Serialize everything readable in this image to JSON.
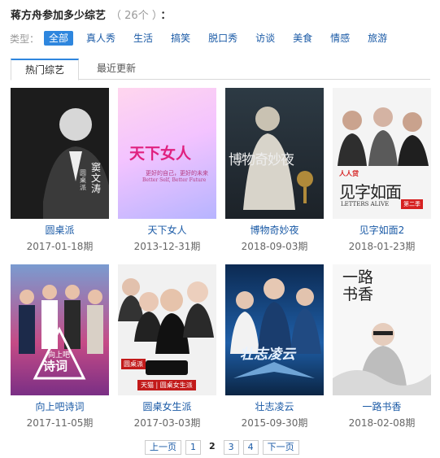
{
  "header": {
    "title": "蒋方舟参加多少综艺",
    "count": "（ 26个 ）",
    "colon": "："
  },
  "filters": {
    "label": "类型：",
    "items": [
      "全部",
      "真人秀",
      "生活",
      "搞笑",
      "脱口秀",
      "访谈",
      "美食",
      "情感",
      "旅游"
    ],
    "active": "全部"
  },
  "tabs": [
    {
      "label": "热门综艺",
      "active": true
    },
    {
      "label": "最近更新",
      "active": false
    }
  ],
  "shows": [
    {
      "name": "圆桌派",
      "date": "2017-01-18期",
      "poster_text": [
        "圆桌派",
        "窦文涛"
      ]
    },
    {
      "name": "天下女人",
      "date": "2013-12-31期",
      "poster_text": [
        "天下女人",
        "更好的自己，更好的未来",
        "Better Self, Better Future"
      ]
    },
    {
      "name": "博物奇妙夜",
      "date": "2018-09-03期",
      "poster_text": [
        "博物奇妙夜"
      ]
    },
    {
      "name": "见字如面2",
      "date": "2018-01-23期",
      "poster_text": [
        "见字如面",
        "LETTERS ALIVE",
        "第二季"
      ]
    },
    {
      "name": "向上吧诗词",
      "date": "2017-11-05期",
      "poster_text": [
        "向上吧",
        "诗词"
      ]
    },
    {
      "name": "圆桌女生派",
      "date": "2017-03-03期",
      "poster_text": [
        "圆桌派",
        "天猫 | 圆桌女生派"
      ]
    },
    {
      "name": "壮志凌云",
      "date": "2015-09-30期",
      "poster_text": [
        "壮志凌云"
      ]
    },
    {
      "name": "一路书香",
      "date": "2018-02-08期",
      "poster_text": [
        "一路书香"
      ]
    }
  ],
  "pagination": {
    "prev": "上一页",
    "pages": [
      "1",
      "2",
      "3",
      "4"
    ],
    "current": "2",
    "next": "下一页"
  }
}
